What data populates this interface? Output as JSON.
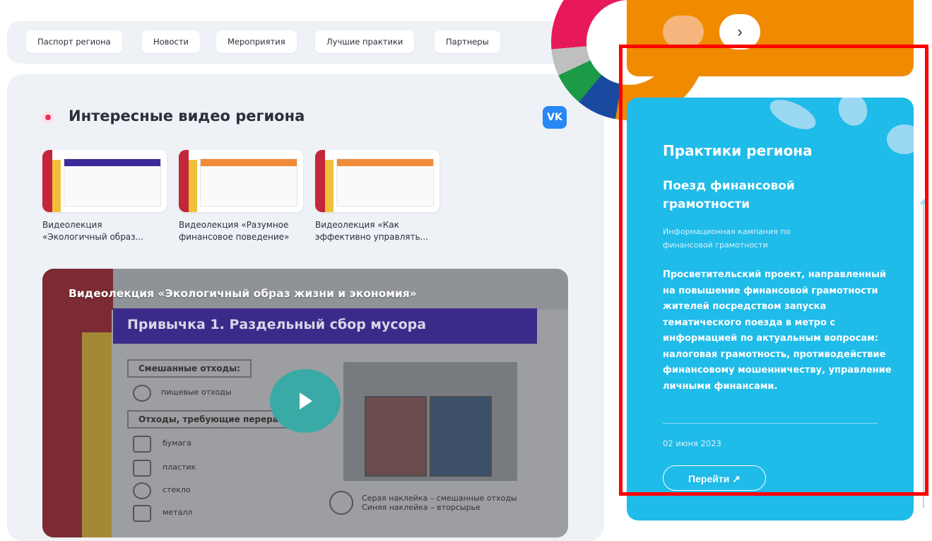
{
  "nav": {
    "items": [
      "Паспорт региона",
      "Новости",
      "Мероприятия",
      "Лучшие практики",
      "Партнеры"
    ]
  },
  "videos_section": {
    "title": "Интересные видео региона",
    "vk_label": "VK",
    "thumbnails": [
      {
        "caption_line1": "Видеолекция",
        "caption_line2": "«Экологичный образ..."
      },
      {
        "caption_line1": "Видеолекция «Разумное",
        "caption_line2": "финансовое поведение»"
      },
      {
        "caption_line1": "Видеолекция «Как",
        "caption_line2": "эффективно управлять..."
      }
    ]
  },
  "player": {
    "title": "Видеолекция «Экологичный образ жизни и экономия»",
    "slide_heading": "Привычка 1. Раздельный сбор мусора",
    "box1": "Смешанные отходы:",
    "item_food": "пищевые отходы",
    "box2": "Отходы, требующие перераб",
    "items": [
      "бумага",
      "пластик",
      "стекло",
      "металл"
    ],
    "note_line1": "Серая наклейка – смешанные отходы",
    "note_line2": "Синяя наклейка – вторсырье"
  },
  "carousel": {
    "prev_icon": "chevron-left-icon",
    "next_icon": "chevron-right-icon",
    "prev_glyph": "‹",
    "next_glyph": "›"
  },
  "practice_card": {
    "heading": "Практики региона",
    "subheading": "Поезд финансовой грамотности",
    "tag": "Информационная кампания по финансовой грамотности",
    "description": "Просветительский проект, направленный на повышение финансовой грамотности жителей посредством запуска тематического поезда в метро с информацией по актуальным вопросам: налоговая грамотность, противодействие финансовому мошенничеству, управление личными финансами.",
    "date": "02 июня 2023",
    "link_label": "Перейти ↗"
  },
  "colors": {
    "orange": "#f08b00",
    "cyan": "#1fbbe9",
    "pink": "#e8195a",
    "highlight": "#ff0000"
  }
}
